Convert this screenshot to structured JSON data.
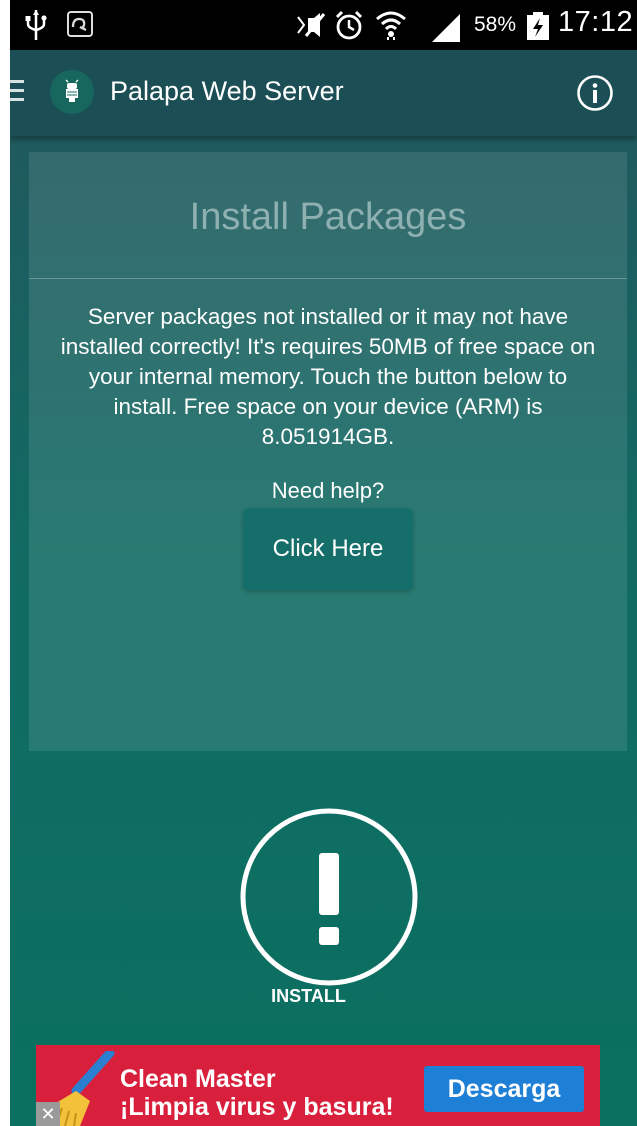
{
  "status_bar": {
    "battery_percent": "58%",
    "time": "17:12",
    "icons": [
      "usb-icon",
      "app-notification-icon",
      "mute-icon",
      "alarm-icon",
      "wifi-icon",
      "signal-icon",
      "battery-charging-icon"
    ]
  },
  "app_bar": {
    "title": "Palapa Web Server",
    "icons": [
      "menu-icon",
      "app-logo-icon",
      "info-icon"
    ]
  },
  "card": {
    "title": "Install Packages",
    "message": "Server packages not installed or it may not have installed correctly! It's requires 50MB of free space on your internal memory. Touch the button below to install. Free space on your device (ARM) is 8.051914GB.",
    "need_help": "Need help?",
    "button_label": "Click Here"
  },
  "install": {
    "label": "INSTALL",
    "icon": "exclamation-circle-icon"
  },
  "ad": {
    "line1": "Clean Master",
    "line2": "¡Limpia virus y basura!",
    "cta": "Descarga",
    "close": "✕",
    "icon": "broom-icon"
  },
  "colors": {
    "status_bar": "#000000",
    "app_bar": "#1b4e55",
    "background_top": "#1f5a5e",
    "background_bottom": "#0a7060",
    "button": "#156e6a",
    "ad_background": "#d81f3c",
    "ad_button": "#1e7fd6"
  }
}
